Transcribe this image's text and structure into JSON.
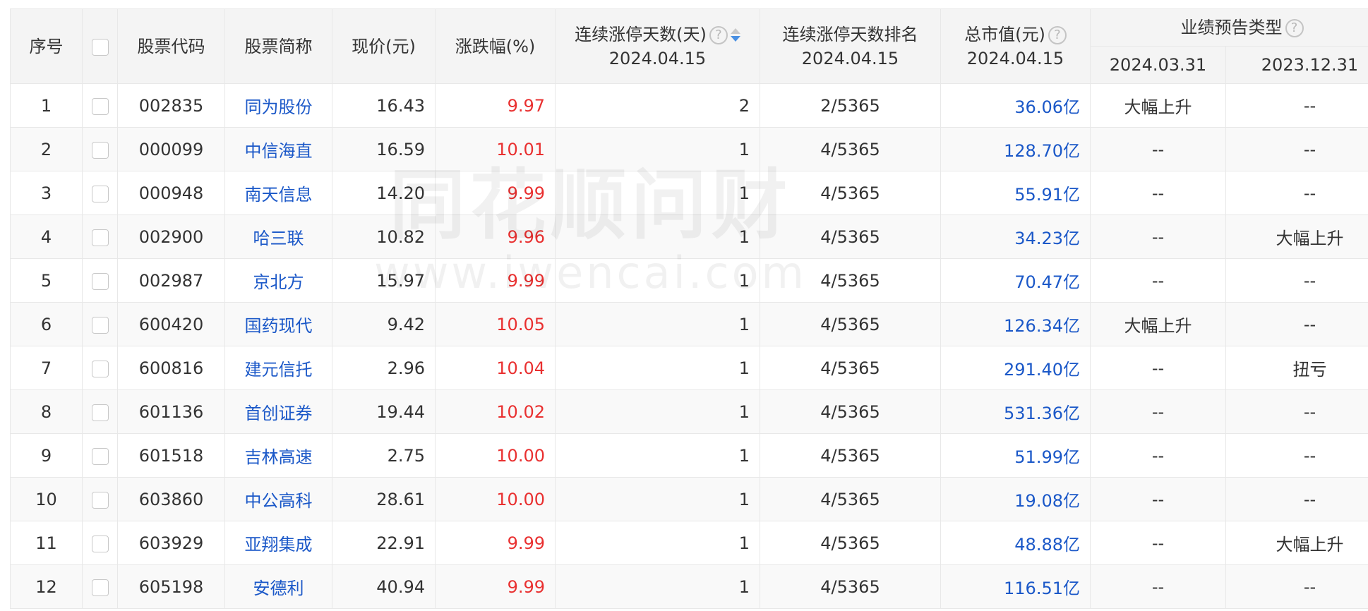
{
  "headers": {
    "index": "序号",
    "code": "股票代码",
    "name": "股票简称",
    "price": "现价(元)",
    "change": "涨跌幅(%)",
    "limit_days": "连续涨停天数(天)",
    "limit_days_date": "2024.04.15",
    "limit_rank": "连续涨停天数排名",
    "limit_rank_date": "2024.04.15",
    "mktcap": "总市值(元)",
    "mktcap_date": "2024.04.15",
    "forecast": "业绩预告类型",
    "forecast_d1": "2024.03.31",
    "forecast_d2": "2023.12.31"
  },
  "help_icon": "?",
  "watermark": {
    "line1": "同花顺问财",
    "line2": "www.iwencai.com"
  },
  "colors": {
    "rise": "#e93030",
    "link": "#1b58c8",
    "header_bg": "#f4f4f4",
    "sort_active": "#4a90e2"
  },
  "rows": [
    {
      "idx": "1",
      "code": "002835",
      "name": "同为股份",
      "price": "16.43",
      "change": "9.97",
      "days": "2",
      "rank": "2/5365",
      "cap": "36.06亿",
      "f1": "大幅上升",
      "f2": "--"
    },
    {
      "idx": "2",
      "code": "000099",
      "name": "中信海直",
      "price": "16.59",
      "change": "10.01",
      "days": "1",
      "rank": "4/5365",
      "cap": "128.70亿",
      "f1": "--",
      "f2": "--"
    },
    {
      "idx": "3",
      "code": "000948",
      "name": "南天信息",
      "price": "14.20",
      "change": "9.99",
      "days": "1",
      "rank": "4/5365",
      "cap": "55.91亿",
      "f1": "--",
      "f2": "--"
    },
    {
      "idx": "4",
      "code": "002900",
      "name": "哈三联",
      "price": "10.82",
      "change": "9.96",
      "days": "1",
      "rank": "4/5365",
      "cap": "34.23亿",
      "f1": "--",
      "f2": "大幅上升"
    },
    {
      "idx": "5",
      "code": "002987",
      "name": "京北方",
      "price": "15.97",
      "change": "9.99",
      "days": "1",
      "rank": "4/5365",
      "cap": "70.47亿",
      "f1": "--",
      "f2": "--"
    },
    {
      "idx": "6",
      "code": "600420",
      "name": "国药现代",
      "price": "9.42",
      "change": "10.05",
      "days": "1",
      "rank": "4/5365",
      "cap": "126.34亿",
      "f1": "大幅上升",
      "f2": "--"
    },
    {
      "idx": "7",
      "code": "600816",
      "name": "建元信托",
      "price": "2.96",
      "change": "10.04",
      "days": "1",
      "rank": "4/5365",
      "cap": "291.40亿",
      "f1": "--",
      "f2": "扭亏"
    },
    {
      "idx": "8",
      "code": "601136",
      "name": "首创证券",
      "price": "19.44",
      "change": "10.02",
      "days": "1",
      "rank": "4/5365",
      "cap": "531.36亿",
      "f1": "--",
      "f2": "--"
    },
    {
      "idx": "9",
      "code": "601518",
      "name": "吉林高速",
      "price": "2.75",
      "change": "10.00",
      "days": "1",
      "rank": "4/5365",
      "cap": "51.99亿",
      "f1": "--",
      "f2": "--"
    },
    {
      "idx": "10",
      "code": "603860",
      "name": "中公高科",
      "price": "28.61",
      "change": "10.00",
      "days": "1",
      "rank": "4/5365",
      "cap": "19.08亿",
      "f1": "--",
      "f2": "--"
    },
    {
      "idx": "11",
      "code": "603929",
      "name": "亚翔集成",
      "price": "22.91",
      "change": "9.99",
      "days": "1",
      "rank": "4/5365",
      "cap": "48.88亿",
      "f1": "--",
      "f2": "大幅上升"
    },
    {
      "idx": "12",
      "code": "605198",
      "name": "安德利",
      "price": "40.94",
      "change": "9.99",
      "days": "1",
      "rank": "4/5365",
      "cap": "116.51亿",
      "f1": "--",
      "f2": "--"
    }
  ]
}
